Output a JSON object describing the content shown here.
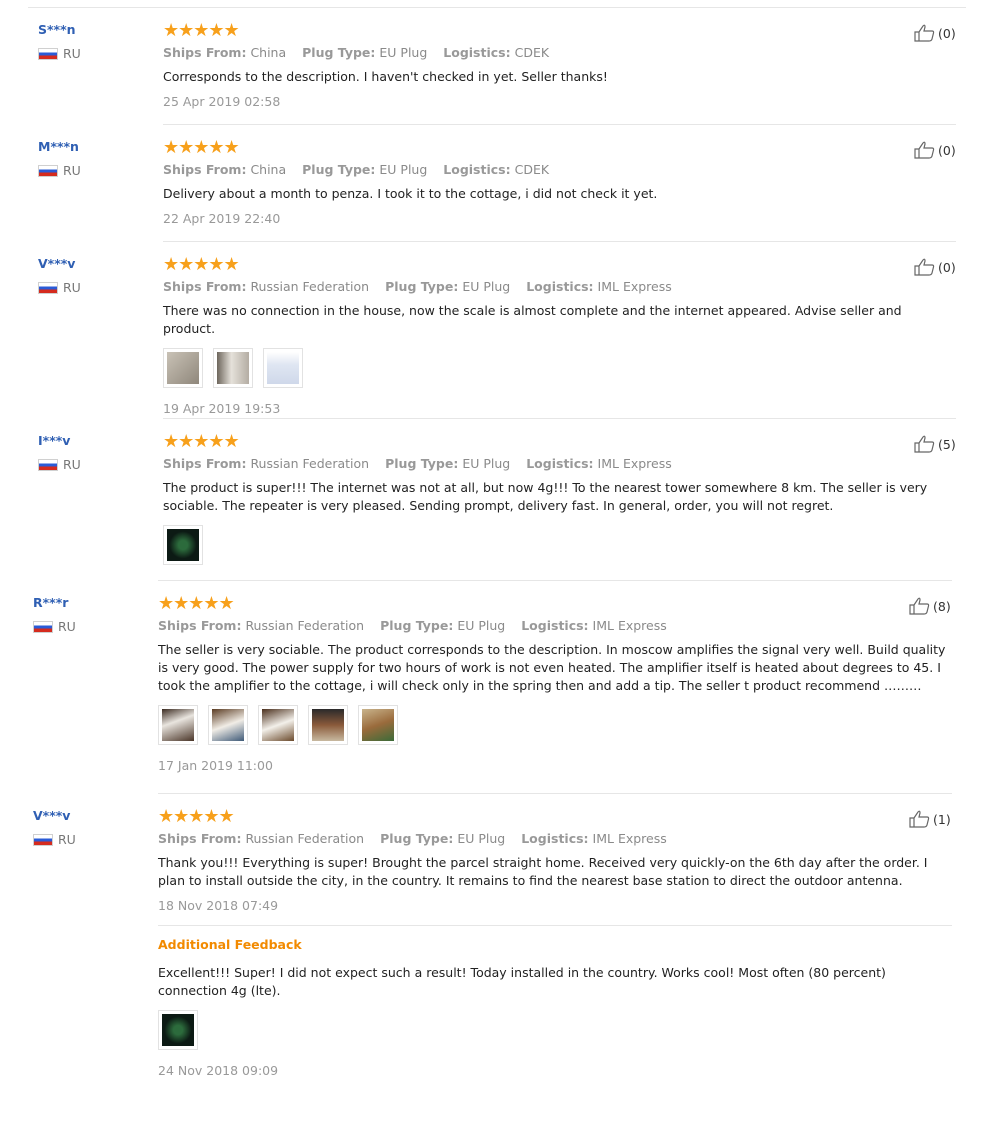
{
  "labels": {
    "ships_from": "Ships From:",
    "plug_type": "Plug Type:",
    "logistics": "Logistics:",
    "additional_feedback": "Additional Feedback"
  },
  "rating_stars": "★★★★★",
  "colors": {
    "username": "#2f5fb3",
    "stars": "#f7a01b",
    "additional_feedback": "#f28a00",
    "meta_gray": "#999999"
  },
  "reviews": [
    {
      "user": "S***n",
      "country": "RU",
      "ships_from": "China",
      "plug_type": "EU Plug",
      "logistics": "CDEK",
      "text": "Corresponds to the description. I haven't checked in yet. Seller thanks!",
      "date": "25 Apr 2019 02:58",
      "helpful": "(0)",
      "rating": 5
    },
    {
      "user": "M***n",
      "country": "RU",
      "ships_from": "China",
      "plug_type": "EU Plug",
      "logistics": "CDEK",
      "text": "Delivery about a month to penza. I took it to the cottage, i did not check it yet.",
      "date": "22 Apr 2019 22:40",
      "helpful": "(0)",
      "rating": 5
    },
    {
      "user": "V***v",
      "country": "RU",
      "ships_from": "Russian Federation",
      "plug_type": "EU Plug",
      "logistics": "IML Express",
      "text": "There was no connection in the house, now the scale is almost complete and the internet appeared. Advise seller and product.",
      "date": "19 Apr 2019 19:53",
      "helpful": "(0)",
      "rating": 5
    },
    {
      "user": "I***v",
      "country": "RU",
      "ships_from": "Russian Federation",
      "plug_type": "EU Plug",
      "logistics": "IML Express",
      "text": "The product is super!!! The internet was not at all, but now 4g!!! To the nearest tower somewhere 8 km. The seller is very sociable. The repeater is very pleased. Sending prompt, delivery fast. In general, order, you will not regret.",
      "helpful": "(5)",
      "rating": 5
    },
    {
      "user": "R***r",
      "country": "RU",
      "ships_from": "Russian Federation",
      "plug_type": "EU Plug",
      "logistics": "IML Express",
      "text": "The seller is very sociable. The product corresponds to the description. In moscow amplifies the signal very well. Build quality is very good. The power supply for two hours of work is not even heated. The amplifier itself is heated about degrees to 45. I took the amplifier to the cottage, i will check only in the spring then and add a tip. The seller t product recommend ………",
      "date": "17 Jan 2019 11:00",
      "helpful": "(8)",
      "rating": 5
    },
    {
      "user": "V***v",
      "country": "RU",
      "ships_from": "Russian Federation",
      "plug_type": "EU Plug",
      "logistics": "IML Express",
      "text": "Thank you!!! Everything is super! Brought the parcel straight home. Received very quickly-on the 6th day after the order. I plan to install outside the city, in the country. It remains to find the nearest base station to direct the outdoor antenna.",
      "date": "18 Nov 2018 07:49",
      "helpful": "(1)",
      "rating": 5,
      "additional_text": "Excellent!!! Super! I did not expect such a result! Today installed in the country. Works cool! Most often (80 percent) connection 4g (lte).",
      "additional_date": "24 Nov 2018 09:09"
    }
  ]
}
